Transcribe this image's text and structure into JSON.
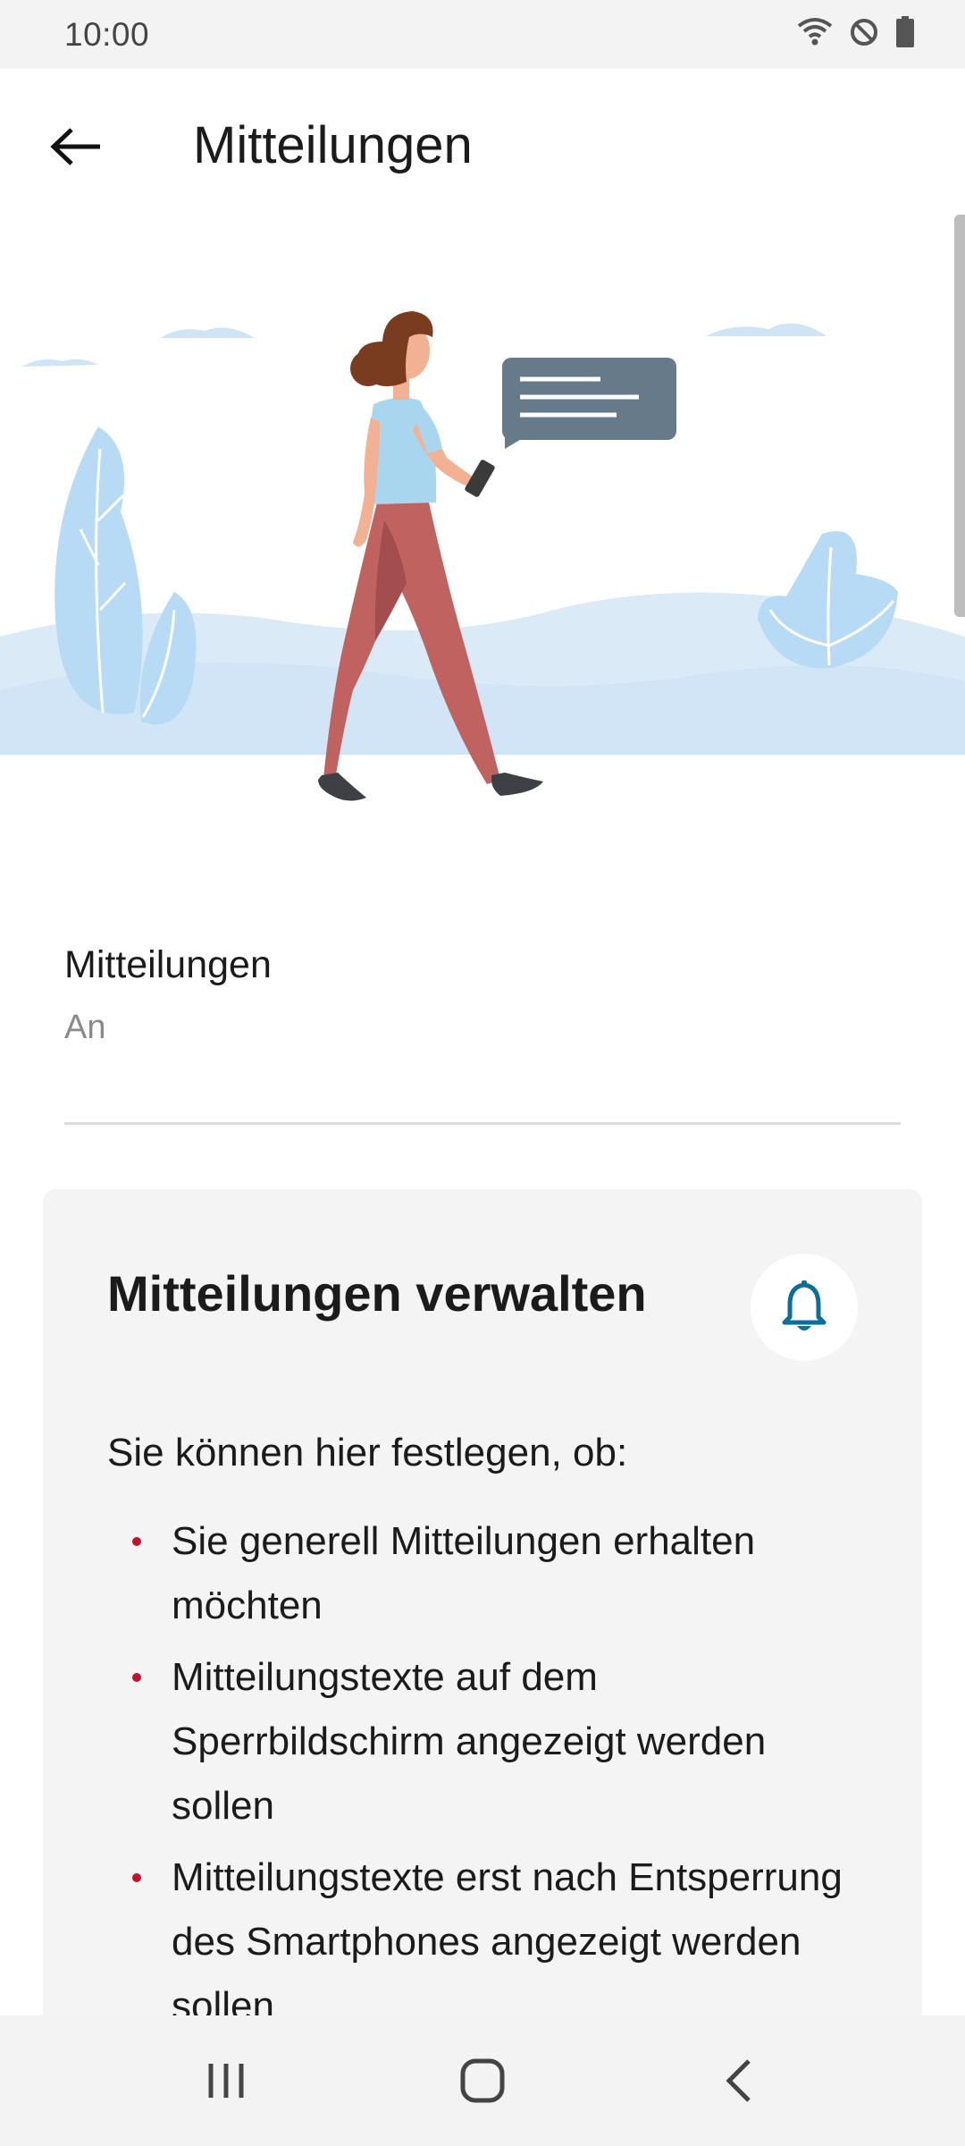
{
  "status_bar": {
    "time": "10:00",
    "icons": [
      "wifi-icon",
      "do-not-disturb-icon",
      "battery-icon"
    ]
  },
  "app_bar": {
    "title": "Mitteilungen",
    "back_icon": "arrow-left-icon"
  },
  "setting": {
    "title": "Mitteilungen",
    "value": "An"
  },
  "card": {
    "title": "Mitteilungen verwalten",
    "icon": "bell-icon",
    "intro": "Sie können hier festlegen, ob:",
    "bullets": [
      "Sie generell Mitteilungen erhalten möchten",
      "Mitteilungstexte auf dem Sperrbildschirm angezeigt werden sollen",
      "Mitteilungstexte erst nach Entsperrung des Smartphones angezeigt werden sollen"
    ]
  },
  "nav_bar": {
    "icons": [
      "recent-apps-icon",
      "home-icon",
      "back-icon"
    ]
  },
  "colors": {
    "accent_blue": "#0d6e9c",
    "bullet_red": "#c8102e",
    "card_bg": "#f4f4f4"
  }
}
